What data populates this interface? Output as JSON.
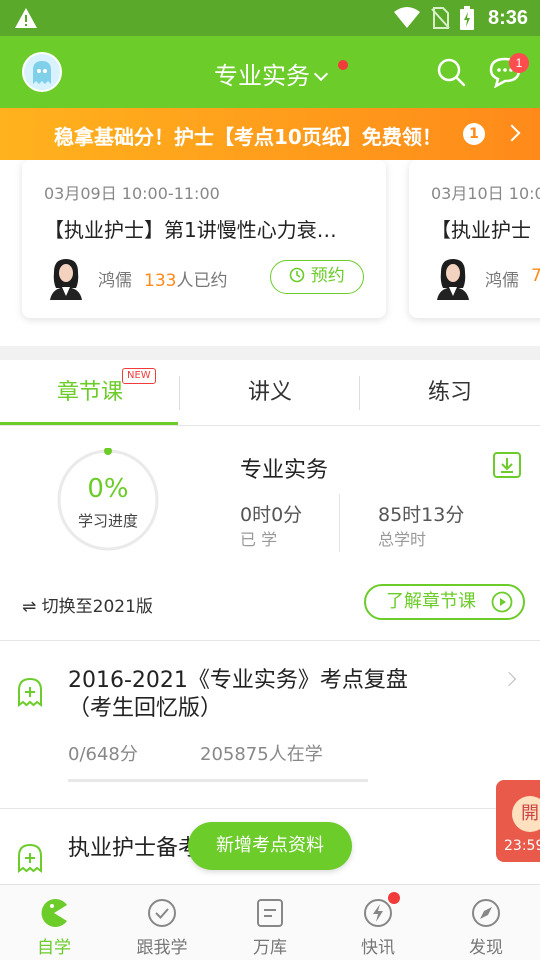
{
  "status_bar": {
    "time": "8:36"
  },
  "header": {
    "title": "专业实务",
    "message_badge": "1"
  },
  "promo": {
    "text": "稳拿基础分！护士【考点10页纸】免费领！",
    "badge": "1"
  },
  "lessons": [
    {
      "date": "03月09日 10:00-11:00",
      "title": "【执业护士】第1讲慢性心力衰…",
      "teacher": "鸿儒",
      "count": "133",
      "count_suffix": "人已约",
      "action": "预约"
    },
    {
      "date": "03月10日 10:0",
      "title": "【执业护士",
      "teacher": "鸿儒",
      "count": "7",
      "count_suffix": "",
      "action": ""
    }
  ],
  "tabs": [
    {
      "label": "章节课",
      "badge": "NEW"
    },
    {
      "label": "讲义"
    },
    {
      "label": "练习"
    }
  ],
  "progress": {
    "percent": "0%",
    "label": "学习进度",
    "course_name": "专业实务",
    "studied_value": "0时0分",
    "studied_label": "已 学",
    "total_value": "85时13分",
    "total_label": "总学时",
    "switch_text": "⇌ 切换至2021版",
    "learn_button": "了解章节课"
  },
  "courses": [
    {
      "title": "2016-2021《专业实务》考点复盘（考生回忆版）",
      "score": "0/648分",
      "learners": "205875人在学"
    },
    {
      "title": "执业护士备考"
    }
  ],
  "toast": "新增考点资料",
  "float_live": {
    "char": "開",
    "time": "23:59"
  },
  "bottom_nav": [
    {
      "label": "自学",
      "icon": "pacman-icon"
    },
    {
      "label": "跟我学",
      "icon": "check-circle-icon"
    },
    {
      "label": "万库",
      "icon": "document-icon"
    },
    {
      "label": "快讯",
      "icon": "lightning-icon"
    },
    {
      "label": "发现",
      "icon": "compass-icon"
    }
  ],
  "colors": {
    "primary": "#6ccc2a",
    "status_bar": "#5aa92a",
    "accent_orange": "#ff8a1a",
    "badge_red": "#f23b3b"
  }
}
